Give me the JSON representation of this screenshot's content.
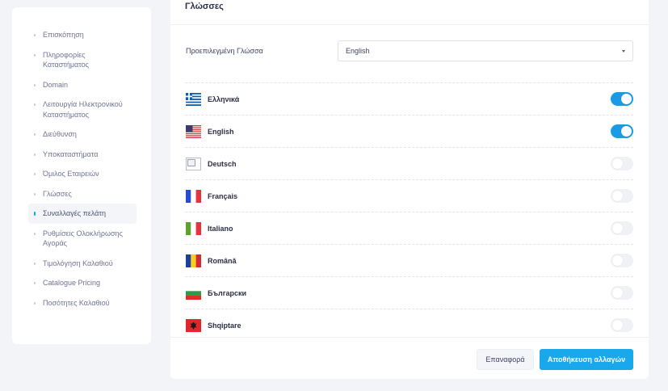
{
  "sidebar": {
    "items": [
      {
        "label": "Επισκόπηση",
        "active": false
      },
      {
        "label": "Πληροφορίες Καταστήματος",
        "active": false
      },
      {
        "label": "Domain",
        "active": false
      },
      {
        "label": "Λειτουργία Ηλεκτρονικού Καταστήματος",
        "active": false
      },
      {
        "label": "Διεύθυνση",
        "active": false
      },
      {
        "label": "Υποκαταστήματα",
        "active": false
      },
      {
        "label": "Όμιλος Εταιρειών",
        "active": false
      },
      {
        "label": "Γλώσσες",
        "active": false
      },
      {
        "label": "Συναλλαγές πελάτη",
        "active": true
      },
      {
        "label": "Ρυθμίσεις Ολοκλήρωσης Αγοράς",
        "active": false
      },
      {
        "label": "Τιμολόγηση Καλαθιού",
        "active": false
      },
      {
        "label": "Catalogue Pricing",
        "active": false
      },
      {
        "label": "Ποσότητες Καλαθιού",
        "active": false
      }
    ]
  },
  "main": {
    "title": "Γλώσσες",
    "default_language_label": "Προεπιλεγμένη Γλώσσα",
    "default_language_value": "English",
    "languages": [
      {
        "name": "Ελληνικά",
        "flag": "greece-flag-icon",
        "enabled": true
      },
      {
        "name": "English",
        "flag": "usa-flag-icon",
        "enabled": true
      },
      {
        "name": "Deutsch",
        "flag": "broken-image-icon",
        "enabled": false
      },
      {
        "name": "Français",
        "flag": "france-flag-icon",
        "enabled": false
      },
      {
        "name": "Italiano",
        "flag": "italy-flag-icon",
        "enabled": false
      },
      {
        "name": "Română",
        "flag": "romania-flag-icon",
        "enabled": false
      },
      {
        "name": "Български",
        "flag": "bulgaria-flag-icon",
        "enabled": false
      },
      {
        "name": "Shqiptare",
        "flag": "albania-flag-icon",
        "enabled": false
      }
    ],
    "reset_label": "Επαναφορά",
    "save_label": "Αποθήκευση αλλαγών"
  },
  "colors": {
    "accent": "#1aa8ec",
    "toggle_on": "#1a9be6",
    "background": "#f3f4f8"
  }
}
